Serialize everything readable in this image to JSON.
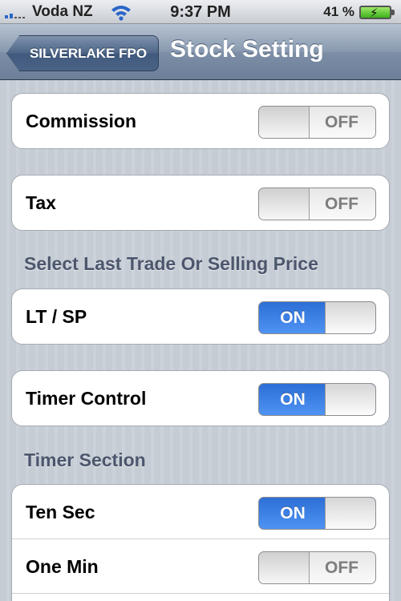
{
  "status_bar": {
    "carrier": "Voda NZ",
    "time": "9:37 PM",
    "battery_percent": "41 %",
    "icons": [
      "signal-icon",
      "wifi-icon",
      "battery-icon"
    ]
  },
  "nav": {
    "back_label": "SILVERLAKE FPO",
    "title": "Stock Setting"
  },
  "groups": {
    "commission": {
      "label": "Commission",
      "state": "OFF"
    },
    "tax": {
      "label": "Tax",
      "state": "OFF"
    },
    "last_trade_header": "Select Last Trade Or Selling Price",
    "lt_sp": {
      "label": "LT / SP",
      "state": "ON"
    },
    "timer_control": {
      "label": "Timer Control",
      "state": "ON"
    },
    "timer_section_header": "Timer Section",
    "ten_sec": {
      "label": "Ten Sec",
      "state": "ON"
    },
    "one_min": {
      "label": "One Min",
      "state": "OFF"
    }
  },
  "colors": {
    "switch_on": "#3a7fe6",
    "nav_bar": "#7d8fa7",
    "background": "#c5ccd4"
  }
}
